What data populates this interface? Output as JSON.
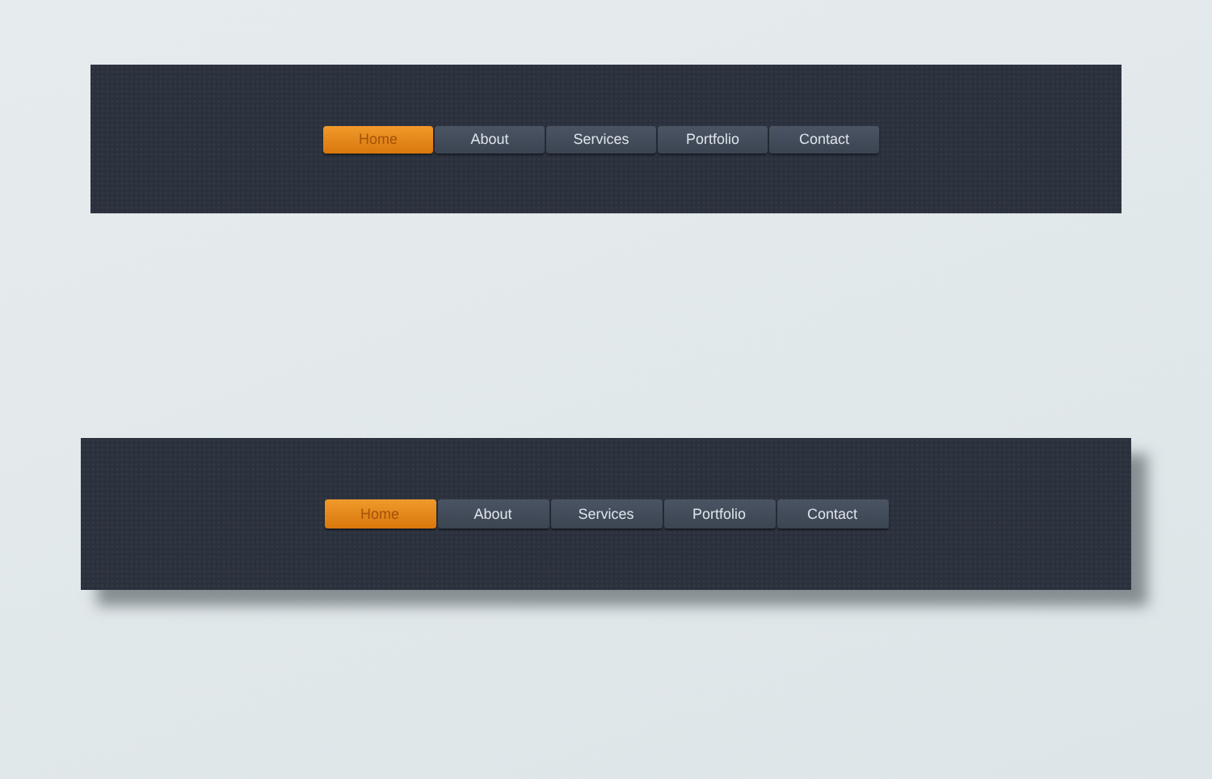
{
  "menus": [
    {
      "kind": "flat",
      "items": [
        {
          "label": "Home",
          "selected": true
        },
        {
          "label": "About",
          "selected": false
        },
        {
          "label": "Services",
          "selected": false
        },
        {
          "label": "Portfolio",
          "selected": false
        },
        {
          "label": "Contact",
          "selected": false
        }
      ]
    },
    {
      "kind": "shadowed",
      "items": [
        {
          "label": "Home",
          "selected": true
        },
        {
          "label": "About",
          "selected": false
        },
        {
          "label": "Services",
          "selected": false
        },
        {
          "label": "Portfolio",
          "selected": false
        },
        {
          "label": "Contact",
          "selected": false
        }
      ]
    }
  ]
}
